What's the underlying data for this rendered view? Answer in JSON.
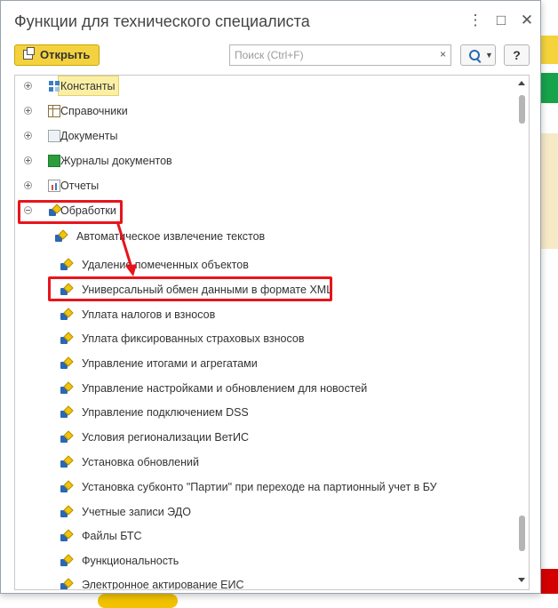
{
  "window": {
    "title": "Функции для технического специалиста",
    "more_icon": "more-vertical-icon",
    "maximize_icon": "maximize-icon",
    "close_icon": "close-icon"
  },
  "toolbar": {
    "open_label": "Открыть",
    "search_placeholder": "Поиск (Ctrl+F)",
    "clear_glyph": "×",
    "help_label": "?"
  },
  "tree": {
    "top_items": [
      {
        "label": "Константы",
        "icon": "constants-icon",
        "selected": true
      },
      {
        "label": "Справочники",
        "icon": "catalog-icon"
      },
      {
        "label": "Документы",
        "icon": "document-icon"
      },
      {
        "label": "Журналы документов",
        "icon": "journal-icon"
      },
      {
        "label": "Отчеты",
        "icon": "report-icon"
      },
      {
        "label": "Обработки",
        "icon": "processing-icon",
        "expanded": true
      }
    ],
    "processing_items": [
      "Автоматическое извлечение текстов",
      "Удаление помеченных объектов",
      "Универсальный обмен данными в формате XML",
      "Уплата налогов и взносов",
      "Уплата фиксированных страховых взносов",
      "Управление итогами и агрегатами",
      "Управление настройками и обновлением для новостей",
      "Управление подключением DSS",
      "Условия регионализации ВетИС",
      "Установка обновлений",
      "Установка субконто \"Партии\" при переходе на партионный учет в БУ",
      "Учетные записи ЭДО",
      "Файлы БТС",
      "Функциональность",
      "Электронное актирование ЕИС"
    ]
  },
  "colors": {
    "highlight": "#e8141c",
    "open_button": "#f4d23f",
    "selection": "#fbefa6"
  }
}
